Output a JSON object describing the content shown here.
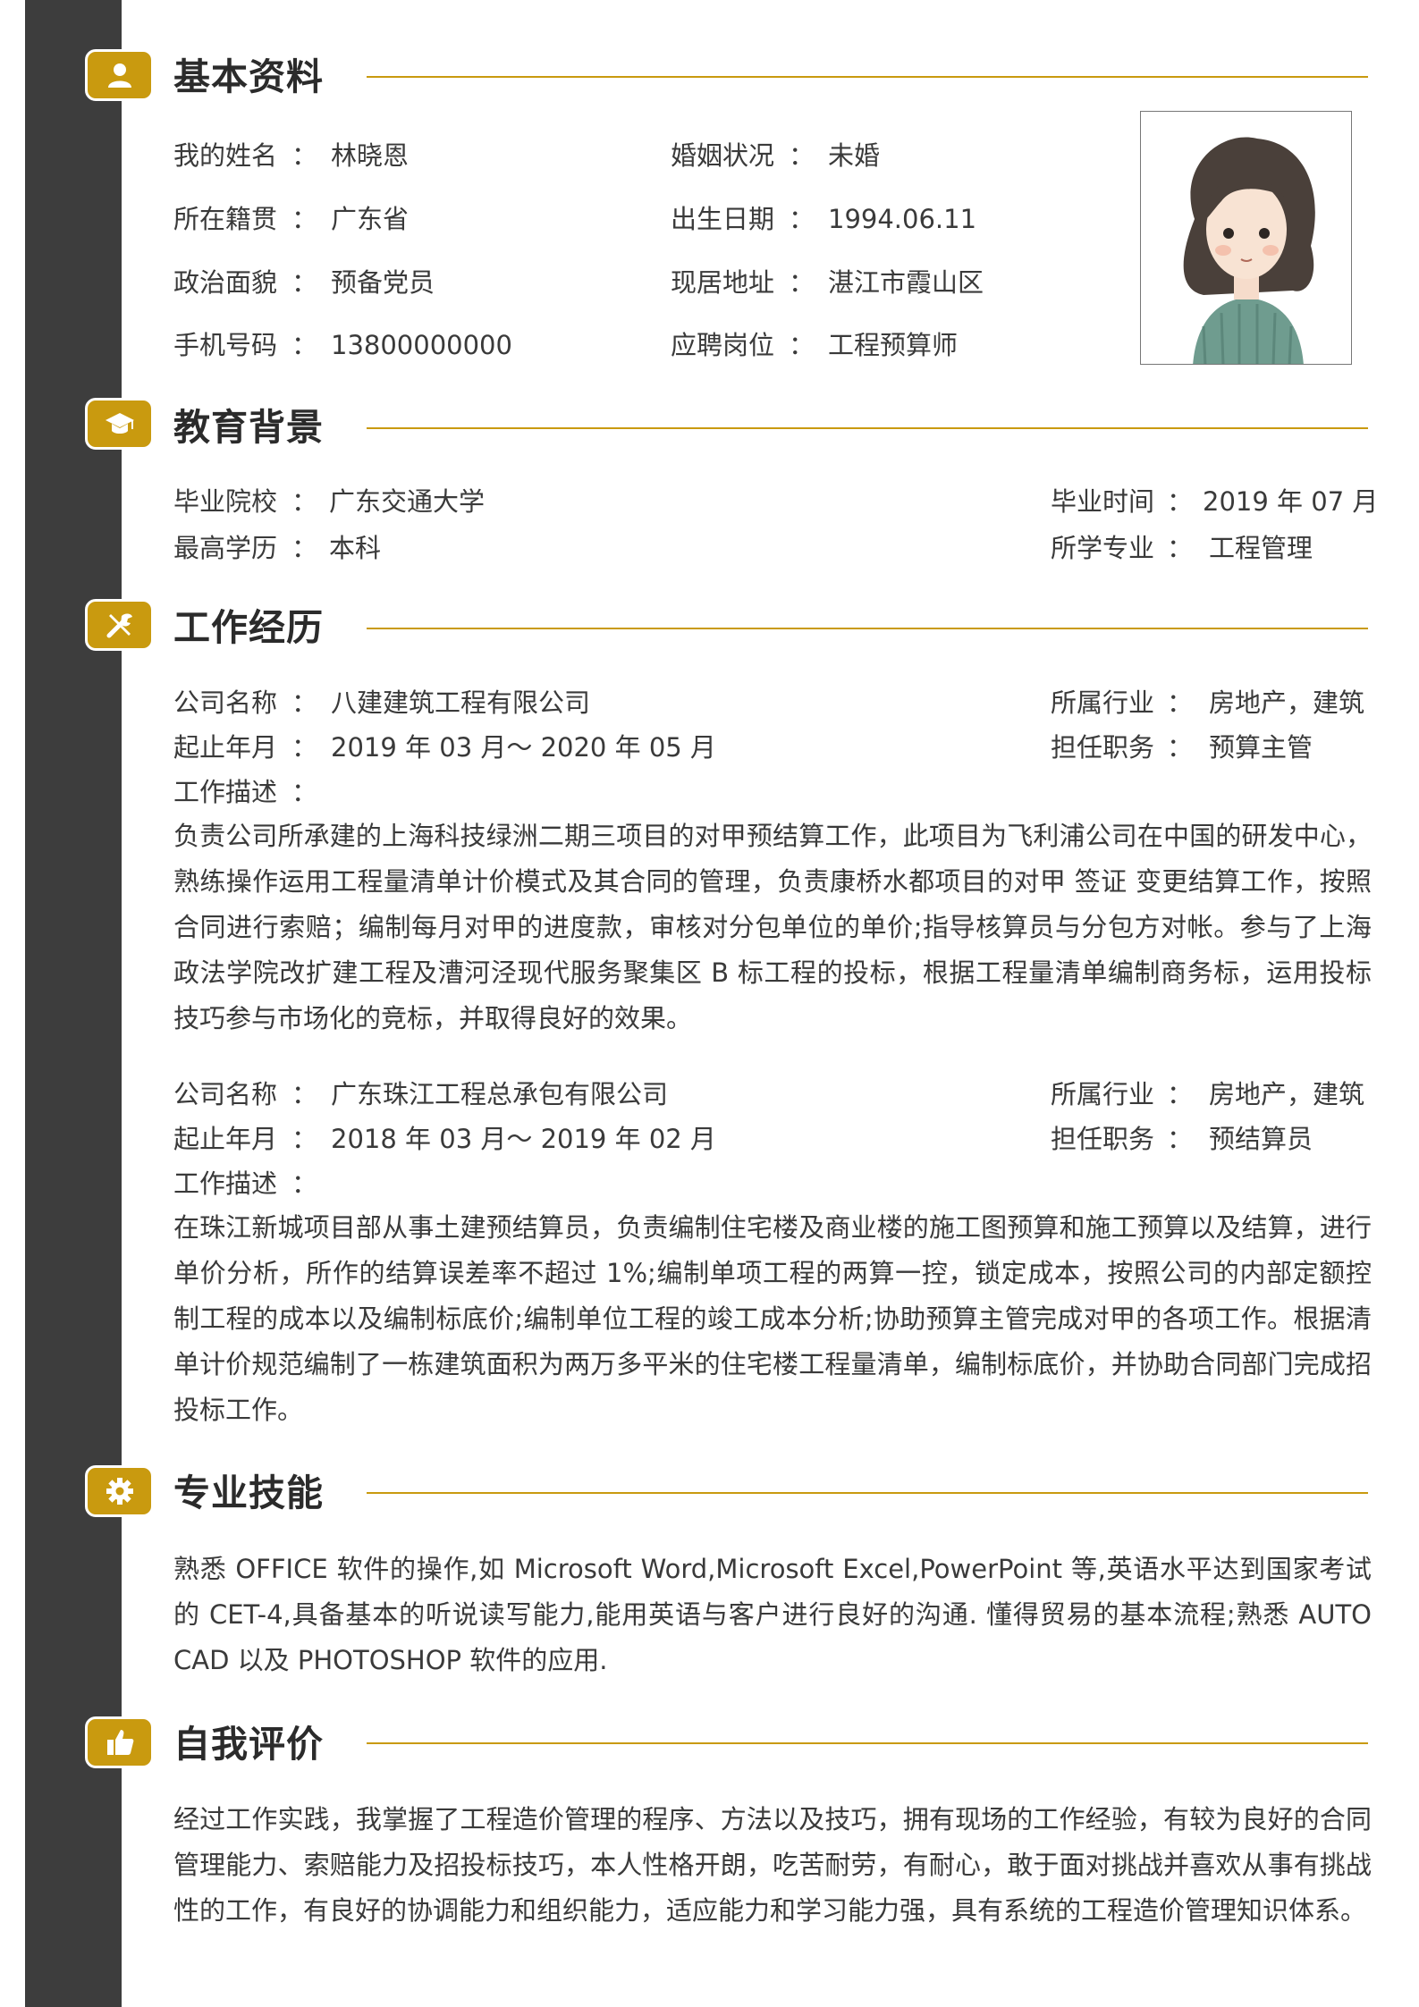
{
  "sections": {
    "basic": "基本资料",
    "education": "教育背景",
    "work": "工作经历",
    "skills": "专业技能",
    "self": "自我评价"
  },
  "icons": {
    "basic": "user-icon",
    "education": "graduation-cap-icon",
    "work": "tools-icon",
    "skills": "gear-icon",
    "self": "thumbs-up-icon"
  },
  "colors": {
    "accent": "#c99a0f",
    "sidebar": "#3d3d3d"
  },
  "separator": "：",
  "basic": {
    "name_label": "我的姓名",
    "name": "林晓恩",
    "marital_label": "婚姻状况",
    "marital": "未婚",
    "origin_label": "所在籍贯",
    "origin": "广东省",
    "birth_label": "出生日期",
    "birth": "1994.06.11",
    "politics_label": "政治面貌",
    "politics": "预备党员",
    "address_label": "现居地址",
    "address": "湛江市霞山区",
    "phone_label": "手机号码",
    "phone": "13800000000",
    "position_label": "应聘岗位",
    "position": "工程预算师"
  },
  "education": {
    "school_label": "毕业院校",
    "school": "广东交通大学",
    "grad_label": "毕业时间",
    "grad": "2019 年 07 月",
    "degree_label": "最高学历",
    "degree": "本科",
    "major_label": "所学专业",
    "major": "工程管理"
  },
  "work": {
    "company_label": "公司名称",
    "industry_label": "所属行业",
    "period_label": "起止年月",
    "role_label": "担任职务",
    "desc_label": "工作描述",
    "jobs": [
      {
        "company": "八建建筑工程有限公司",
        "industry": "房地产，建筑",
        "period": "2019 年 03 月～ 2020 年 05 月",
        "role": "预算主管",
        "desc": "负责公司所承建的上海科技绿洲二期三项目的对甲预结算工作，此项目为飞利浦公司在中国的研发中心，熟练操作运用工程量清单计价模式及其合同的管理，负责康桥水都项目的对甲 签证 变更结算工作，按照合同进行索赔；编制每月对甲的进度款，审核对分包单位的单价;指导核算员与分包方对帐。参与了上海政法学院改扩建工程及漕河泾现代服务聚集区 B 标工程的投标，根据工程量清单编制商务标，运用投标技巧参与市场化的竞标，并取得良好的效果。"
      },
      {
        "company": "广东珠江工程总承包有限公司",
        "industry": "房地产，建筑",
        "period": "2018 年 03 月～ 2019 年 02 月",
        "role": "预结算员",
        "desc": "在珠江新城项目部从事土建预结算员，负责编制住宅楼及商业楼的施工图预算和施工预算以及结算，进行单价分析，所作的结算误差率不超过 1%;编制单项工程的两算一控，锁定成本，按照公司的内部定额控制工程的成本以及编制标底价;编制单位工程的竣工成本分析;协助预算主管完成对甲的各项工作。根据清单计价规范编制了一栋建筑面积为两万多平米的住宅楼工程量清单，编制标底价，并协助合同部门完成招投标工作。"
      }
    ]
  },
  "skills": "熟悉 OFFICE 软件的操作,如 Microsoft Word,Microsoft Excel,PowerPoint 等,英语水平达到国家考试的 CET-4,具备基本的听说读写能力,能用英语与客户进行良好的沟通. 懂得贸易的基本流程;熟悉 AUTO CAD 以及 PHOTOSHOP 软件的应用.",
  "self": "经过工作实践，我掌握了工程造价管理的程序、方法以及技巧，拥有现场的工作经验，有较为良好的合同管理能力、索赔能力及招投标技巧，本人性格开朗，吃苦耐劳，有耐心，敢于面对挑战并喜欢从事有挑战性的工作，有良好的协调能力和组织能力，适应能力和学习能力强，具有系统的工程造价管理知识体系。"
}
